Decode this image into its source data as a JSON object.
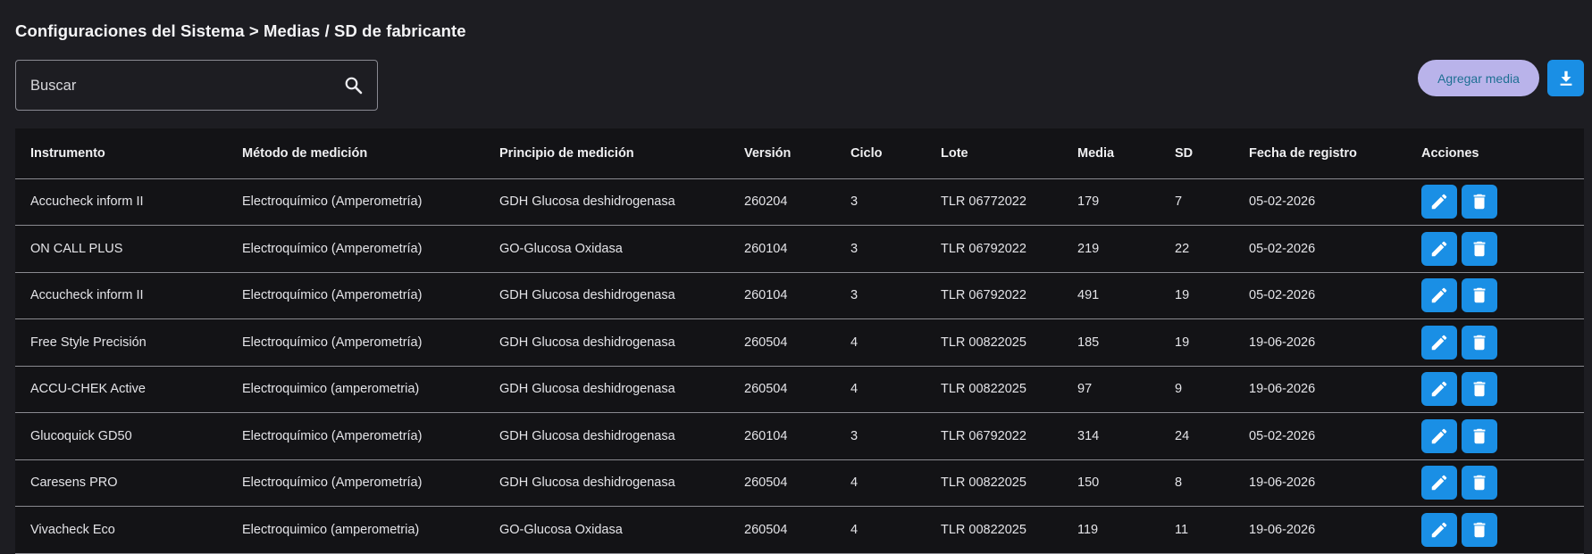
{
  "breadcrumb": "Configuraciones del Sistema > Medias / SD de fabricante",
  "search": {
    "placeholder": "Buscar",
    "value": ""
  },
  "toolbar": {
    "add_label": "Agregar media"
  },
  "colors": {
    "accent": "#1a8fe5",
    "add_button_bg": "#b9b3ea",
    "add_button_text": "#1e6f93",
    "background": "#1d1d22",
    "table_bg": "#131316"
  },
  "icons": {
    "search": "search-icon",
    "download": "download-icon",
    "edit": "pencil-icon",
    "delete": "trash-icon"
  },
  "table": {
    "headers": [
      "Instrumento",
      "Método de medición",
      "Principio de medición",
      "Versión",
      "Ciclo",
      "Lote",
      "Media",
      "SD",
      "Fecha de registro",
      "Acciones"
    ],
    "rows": [
      [
        "Accucheck inform II",
        "Electroquímico (Amperometría)",
        "GDH Glucosa deshidrogenasa",
        "260204",
        "3",
        "TLR 06772022",
        "179",
        "7",
        "05-02-2026"
      ],
      [
        "ON CALL PLUS",
        "Electroquímico (Amperometría)",
        "GO-Glucosa Oxidasa",
        "260104",
        "3",
        "TLR 06792022",
        "219",
        "22",
        "05-02-2026"
      ],
      [
        "Accucheck inform II",
        "Electroquímico (Amperometría)",
        "GDH Glucosa deshidrogenasa",
        "260104",
        "3",
        "TLR 06792022",
        "491",
        "19",
        "05-02-2026"
      ],
      [
        "Free Style Precisión",
        "Electroquímico (Amperometría)",
        "GDH Glucosa deshidrogenasa",
        "260504",
        "4",
        "TLR 00822025",
        "185",
        "19",
        "19-06-2026"
      ],
      [
        "ACCU-CHEK Active",
        "Electroquimico (amperometria)",
        "GDH Glucosa deshidrogenasa",
        "260504",
        "4",
        "TLR 00822025",
        "97",
        "9",
        "19-06-2026"
      ],
      [
        "Glucoquick GD50",
        "Electroquímico (Amperometría)",
        "GDH Glucosa deshidrogenasa",
        "260104",
        "3",
        "TLR 06792022",
        "314",
        "24",
        "05-02-2026"
      ],
      [
        "Caresens PRO",
        "Electroquímico (Amperometría)",
        "GDH Glucosa deshidrogenasa",
        "260504",
        "4",
        "TLR 00822025",
        "150",
        "8",
        "19-06-2026"
      ],
      [
        "Vivacheck Eco",
        "Electroquimico (amperometria)",
        "GO-Glucosa Oxidasa",
        "260504",
        "4",
        "TLR 00822025",
        "119",
        "11",
        "19-06-2026"
      ]
    ]
  }
}
